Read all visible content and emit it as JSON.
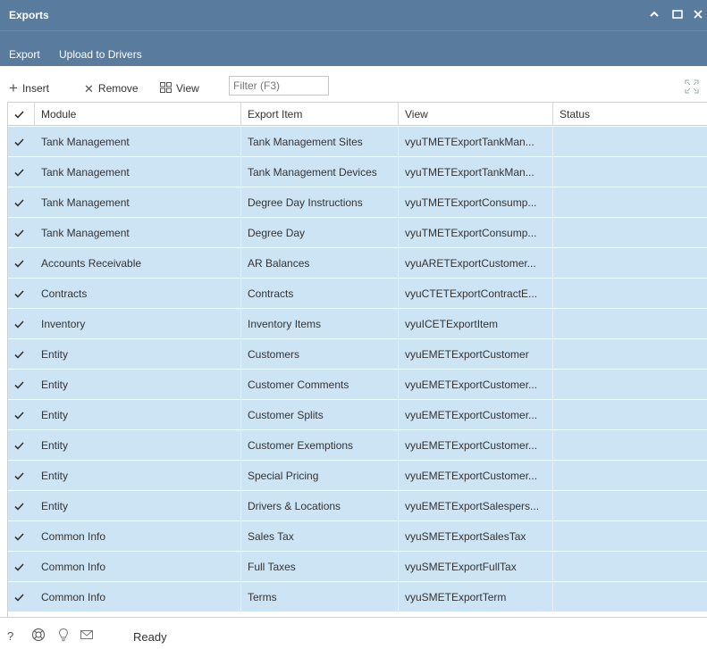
{
  "window": {
    "title": "Exports",
    "buttons": {
      "collapse_icon": "chevron-up-icon",
      "maximize_icon": "maximize-icon",
      "close_icon": "close-icon"
    }
  },
  "menu": {
    "items": [
      {
        "label": "Export"
      },
      {
        "label": "Upload to Drivers"
      }
    ]
  },
  "toolbar": {
    "insert_label": "Insert",
    "remove_label": "Remove",
    "view_label": "View",
    "filter_placeholder": "Filter (F3)"
  },
  "grid": {
    "columns": [
      "Module",
      "Export Item",
      "View",
      "Status"
    ],
    "row_color": "#cde4f5",
    "rows": [
      {
        "module": "Tank Management",
        "item": "Tank Management Sites",
        "view": "vyuTMETExportTankMan...",
        "status": ""
      },
      {
        "module": "Tank Management",
        "item": "Tank Management Devices",
        "view": "vyuTMETExportTankMan...",
        "status": ""
      },
      {
        "module": "Tank Management",
        "item": "Degree Day Instructions",
        "view": "vyuTMETExportConsump...",
        "status": ""
      },
      {
        "module": "Tank Management",
        "item": "Degree Day",
        "view": "vyuTMETExportConsump...",
        "status": ""
      },
      {
        "module": "Accounts Receivable",
        "item": "AR Balances",
        "view": "vyuARETExportCustomer...",
        "status": ""
      },
      {
        "module": "Contracts",
        "item": "Contracts",
        "view": "vyuCTETExportContractE...",
        "status": ""
      },
      {
        "module": "Inventory",
        "item": "Inventory Items",
        "view": "vyuICETExportItem",
        "status": ""
      },
      {
        "module": "Entity",
        "item": "Customers",
        "view": "vyuEMETExportCustomer",
        "status": ""
      },
      {
        "module": "Entity",
        "item": "Customer Comments",
        "view": "vyuEMETExportCustomer...",
        "status": ""
      },
      {
        "module": "Entity",
        "item": "Customer Splits",
        "view": "vyuEMETExportCustomer...",
        "status": ""
      },
      {
        "module": "Entity",
        "item": "Customer Exemptions",
        "view": "vyuEMETExportCustomer...",
        "status": ""
      },
      {
        "module": "Entity",
        "item": "Special Pricing",
        "view": "vyuEMETExportCustomer...",
        "status": ""
      },
      {
        "module": "Entity",
        "item": "Drivers & Locations",
        "view": "vyuEMETExportSalespers...",
        "status": ""
      },
      {
        "module": "Common Info",
        "item": "Sales Tax",
        "view": "vyuSMETExportSalesTax",
        "status": ""
      },
      {
        "module": "Common Info",
        "item": "Full Taxes",
        "view": "vyuSMETExportFullTax",
        "status": ""
      },
      {
        "module": "Common Info",
        "item": "Terms",
        "view": "vyuSMETExportTerm",
        "status": ""
      }
    ]
  },
  "statusbar": {
    "text": "Ready",
    "icons": [
      "help-icon",
      "support-icon",
      "idea-bulb-icon",
      "mail-icon"
    ]
  }
}
